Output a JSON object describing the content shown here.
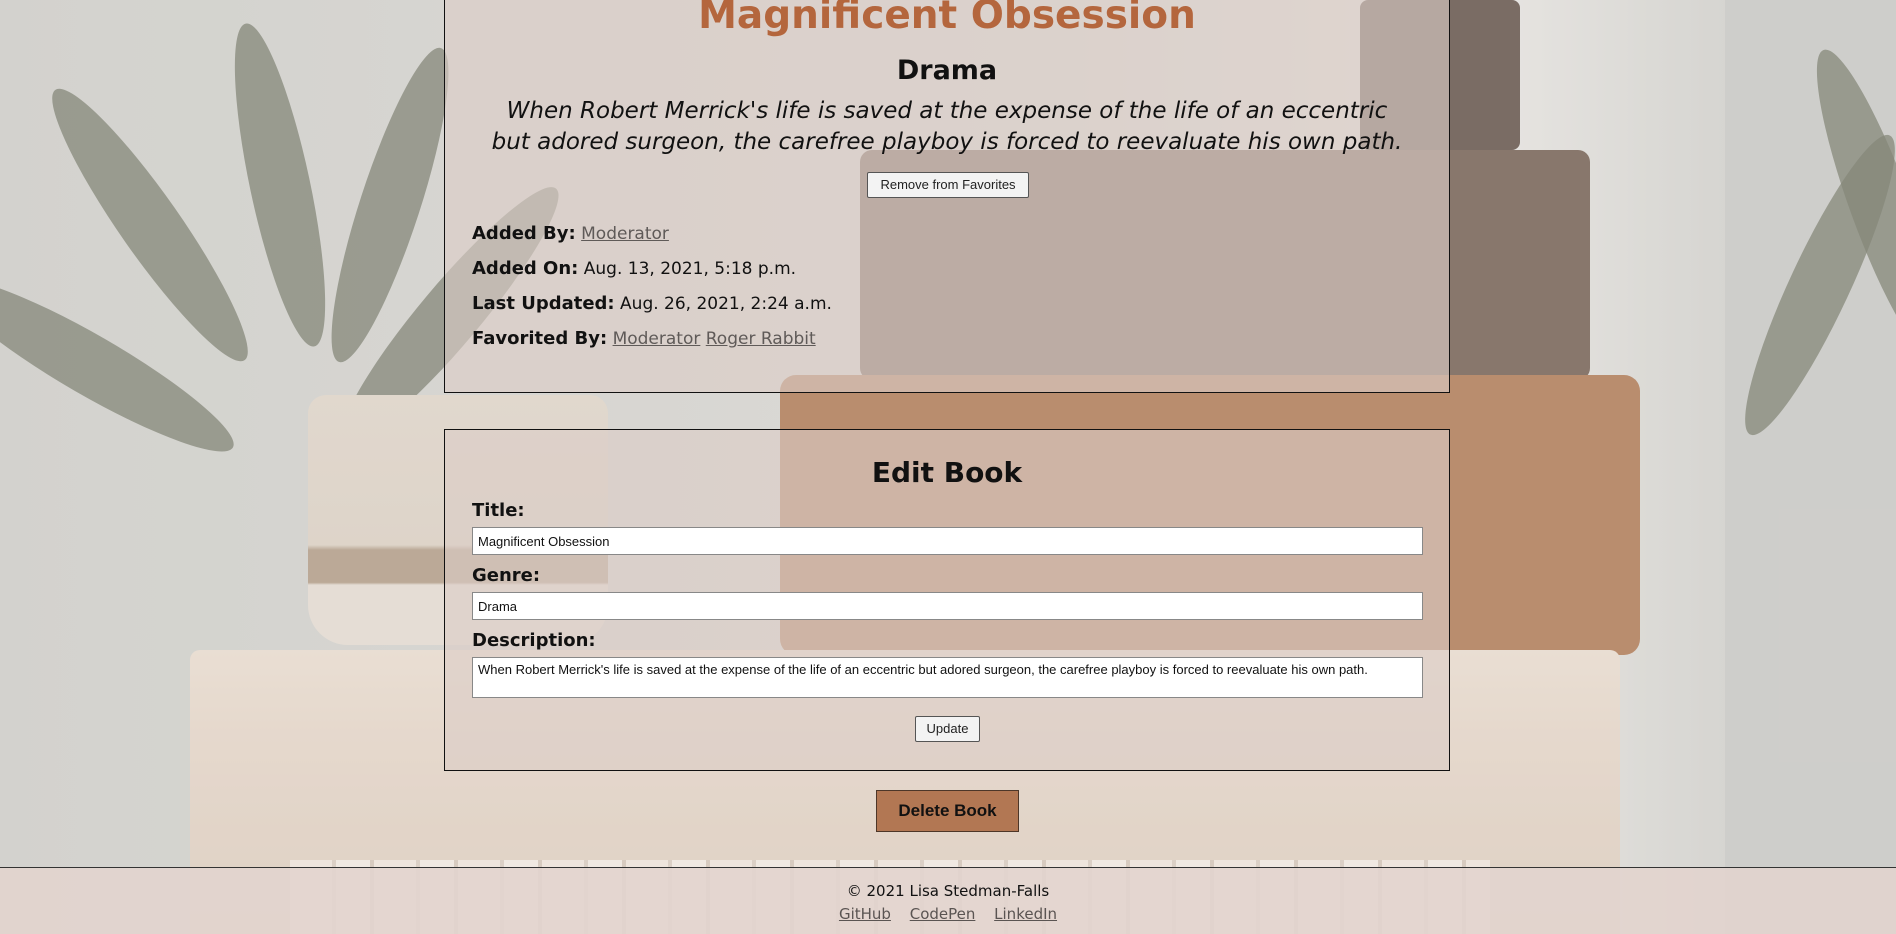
{
  "book": {
    "title": "Magnificent Obsession",
    "genre": "Drama",
    "description": "When Robert Merrick's life is saved at the expense of the life of an eccentric but adored surgeon, the carefree playboy is forced to reevaluate his own path.",
    "remove_favorite_label": "Remove from Favorites",
    "added_by_label": "Added By:",
    "added_by_user": "Moderator",
    "added_on_label": "Added On:",
    "added_on_value": "Aug. 13, 2021, 5:18 p.m.",
    "last_updated_label": "Last Updated:",
    "last_updated_value": "Aug. 26, 2021, 2:24 a.m.",
    "favorited_by_label": "Favorited By:",
    "favorited_by": [
      "Moderator",
      "Roger Rabbit"
    ]
  },
  "edit_form": {
    "heading": "Edit Book",
    "title_label": "Title:",
    "title_value": "Magnificent Obsession",
    "genre_label": "Genre:",
    "genre_value": "Drama",
    "description_label": "Description:",
    "description_value": "When Robert Merrick's life is saved at the expense of the life of an eccentric but adored surgeon, the carefree playboy is forced to reevaluate his own path.",
    "update_label": "Update"
  },
  "delete_label": "Delete Book",
  "footer": {
    "copyright": "© 2021 Lisa Stedman-Falls",
    "links": [
      "GitHub",
      "CodePen",
      "LinkedIn"
    ]
  },
  "colors": {
    "title_accent": "#b4663d",
    "delete_button": "#b27753"
  }
}
